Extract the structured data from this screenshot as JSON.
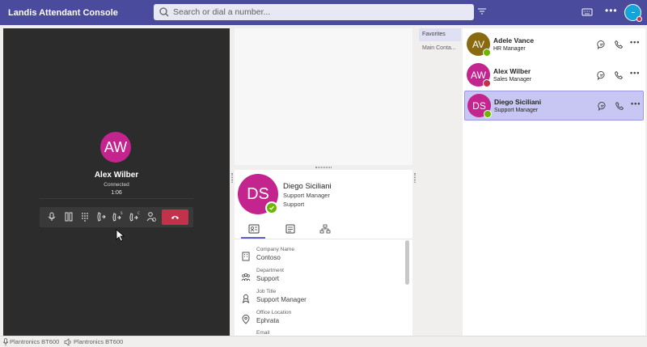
{
  "app": {
    "title": "Landis Attendant Console"
  },
  "search": {
    "placeholder": "Search or dial a number..."
  },
  "call": {
    "initials": "AW",
    "name": "Alex Wilber",
    "status": "Connected",
    "timer": "1:06",
    "avatar_color": "#c4248d",
    "hangup_color": "#c4314b"
  },
  "detail": {
    "initials": "DS",
    "name": "Diego Siciliani",
    "title": "Support Manager",
    "department": "Support",
    "fields": [
      {
        "label": "Company Name",
        "value": "Contoso",
        "icon": "building-icon"
      },
      {
        "label": "Department",
        "value": "Support",
        "icon": "people-icon"
      },
      {
        "label": "Job Title",
        "value": "Support Manager",
        "icon": "badge-icon"
      },
      {
        "label": "Office Location",
        "value": "Ephrata",
        "icon": "location-icon"
      },
      {
        "label": "Email",
        "value": "",
        "icon": "mail-icon"
      }
    ]
  },
  "favorites": {
    "tabs": [
      "Favorites",
      "Main Conta..."
    ]
  },
  "contacts": [
    {
      "initials": "AV",
      "name": "Adele Vance",
      "role": "HR Manager",
      "color": "#8a6a10",
      "presence": "available"
    },
    {
      "initials": "AW",
      "name": "Alex Wilber",
      "role": "Sales Manager",
      "color": "#c4248d",
      "presence": "busy"
    },
    {
      "initials": "DS",
      "name": "Diego Siciliani",
      "role": "Support Manager",
      "color": "#c4248d",
      "presence": "available"
    }
  ],
  "footer": {
    "mic_device": "Plantronics BT600",
    "speaker_device": "Plantronics BT600"
  },
  "colors": {
    "topbar": "#4a4b9c",
    "accent": "#5b5fc7",
    "available": "#6bb700",
    "busy": "#c4314b"
  }
}
